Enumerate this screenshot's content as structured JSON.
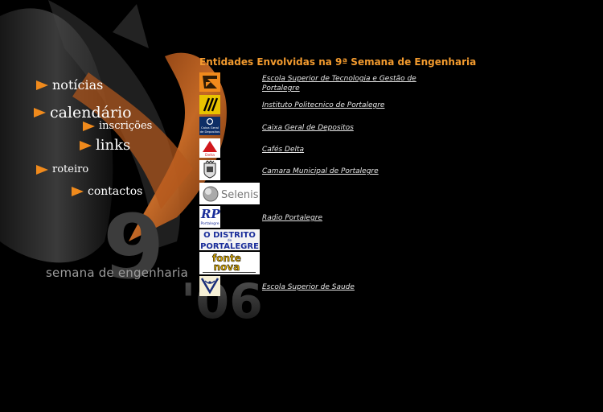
{
  "nav": {
    "items": [
      {
        "label": "notícias"
      },
      {
        "label": "calendário"
      },
      {
        "label": "inscrições"
      },
      {
        "label": "links"
      },
      {
        "label": "roteiro"
      },
      {
        "label": "contactos"
      }
    ]
  },
  "branding": {
    "tagline": "semana de engenharia",
    "big_number": "9",
    "year": "'06"
  },
  "page": {
    "title": "Entidades Envolvidas na 9ª Semana de Engenharia"
  },
  "entities": [
    {
      "name": "Escola Superior de Tecnologia e Gestão de Portalegre",
      "logo": "estg-logo"
    },
    {
      "name": "Instituto Politecnico de Portalegre",
      "logo": "ipp-logo"
    },
    {
      "name": "Caixa Geral de Depositos",
      "logo": "cgd-logo"
    },
    {
      "name": "Cafés Delta",
      "logo": "delta-logo"
    },
    {
      "name": "Camara Municipal de Portalegre",
      "logo": "cmp-logo"
    },
    {
      "name": "",
      "logo": "selenis-logo"
    },
    {
      "name": "Radio Portalegre",
      "logo": "rp-logo"
    },
    {
      "name": "",
      "logo": "o-distrito-logo"
    },
    {
      "name": "",
      "logo": "fonte-nova-logo"
    },
    {
      "name": "Escola Superior de Saude",
      "logo": "ess-logo"
    }
  ],
  "logo_text": {
    "cgd": "Caixa Geral de Depositos",
    "selenis": "Selenis",
    "rp": "Portalegre",
    "o_distrito_1": "O DISTRITO",
    "o_distrito_2": "de",
    "o_distrito_3": "PORTALEGRE",
    "fonte_nova_1": "fonte",
    "fonte_nova_2": "nova",
    "delta": "Delta"
  },
  "colors": {
    "accent": "#f08a1c",
    "title": "#f29a2e",
    "background": "#000000"
  }
}
